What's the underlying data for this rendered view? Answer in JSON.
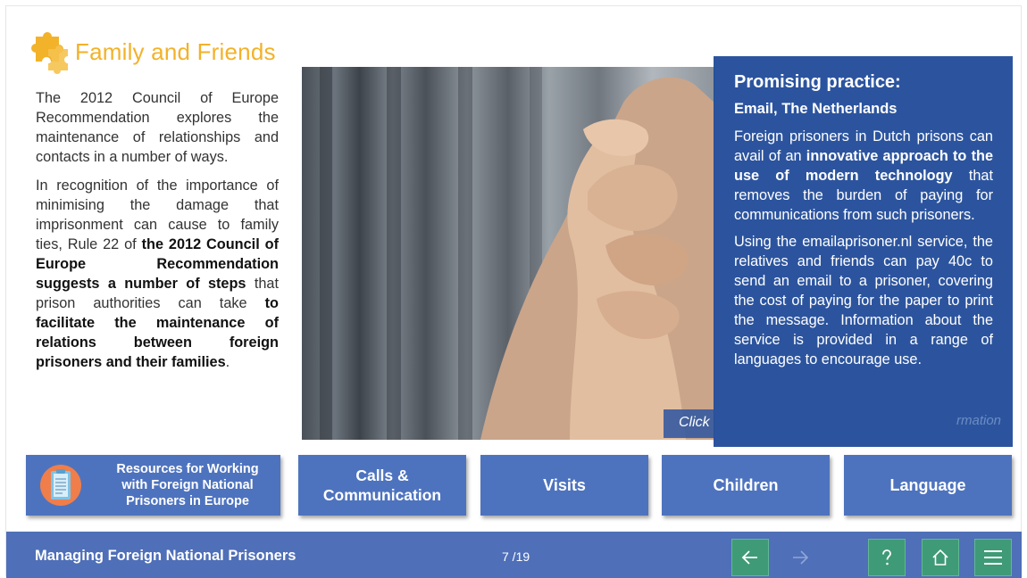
{
  "page": {
    "title": "Family and Friends",
    "paragraph1": "The 2012 Council of Europe Recommendation explores the maintenance of relationships and contacts in a number of ways.",
    "p2_part1": "In recognition of the importance of minimising the damage that imprisonment can cause to family ties, Rule 22 of ",
    "p2_bold1": "the 2012 Council of Europe Recommendation suggests a number of steps",
    "p2_part2": " that prison authorities can take ",
    "p2_bold2": "to facilitate the maintenance of relations between foreign prisoners and their families",
    "p2_end": "."
  },
  "panel": {
    "title": "Promising practice:",
    "subtitle": "Email, The Netherlands",
    "p1_part1": "Foreign prisoners in Dutch prisons can avail of an ",
    "p1_bold": "innovative approach to the use of modern technology",
    "p1_part2": " that removes the burden of paying for communications from such prisoners.",
    "p2": "Using the emailaprisoner.nl service, the relatives and friends can pay 40c to send an email to a prisoner, covering the cost of paying for the paper to print the message. Information about the service is provided in a range of languages to encourage use."
  },
  "hint": {
    "click": "Click",
    "tail": "rmation"
  },
  "buttons": {
    "resources": "Resources for Working with Foreign National Prisoners in Europe",
    "calls": "Calls & Communication",
    "visits": "Visits",
    "children": "Children",
    "language": "Language"
  },
  "footer": {
    "course_title": "Managing Foreign National Prisoners",
    "page_count": "7 /19"
  },
  "icons": {
    "title_icon": "puzzle-icon",
    "resources_icon": "document-icon",
    "back": "arrow-left-icon",
    "next": "arrow-right-icon",
    "help": "question-icon",
    "home": "home-icon",
    "menu": "menu-icon"
  },
  "colors": {
    "title": "#f2b22a",
    "panel": "#1a4596",
    "button": "#4e73be",
    "footer": "#4f6fb8",
    "footer_button": "#3f9a77"
  }
}
